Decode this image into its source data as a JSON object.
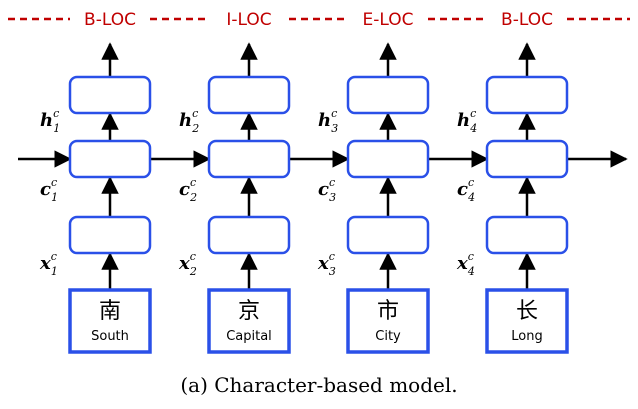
{
  "columns": [
    {
      "tag": "B-LOC",
      "character": "南",
      "gloss": "South",
      "index": "1"
    },
    {
      "tag": "I-LOC",
      "character": "京",
      "gloss": "Capital",
      "index": "2"
    },
    {
      "tag": "E-LOC",
      "character": "市",
      "gloss": "City",
      "index": "3"
    },
    {
      "tag": "B-LOC",
      "character": "长",
      "gloss": "Long",
      "index": "4"
    }
  ],
  "labels": {
    "hidden": "h",
    "cell": "c",
    "input": "x",
    "superscript": "c"
  },
  "caption": "(a)  Character-based model.",
  "colors": {
    "box_stroke": "#2a50e8",
    "tag_text": "#c00000",
    "dash_line": "#c00000",
    "arrow": "#000000"
  }
}
